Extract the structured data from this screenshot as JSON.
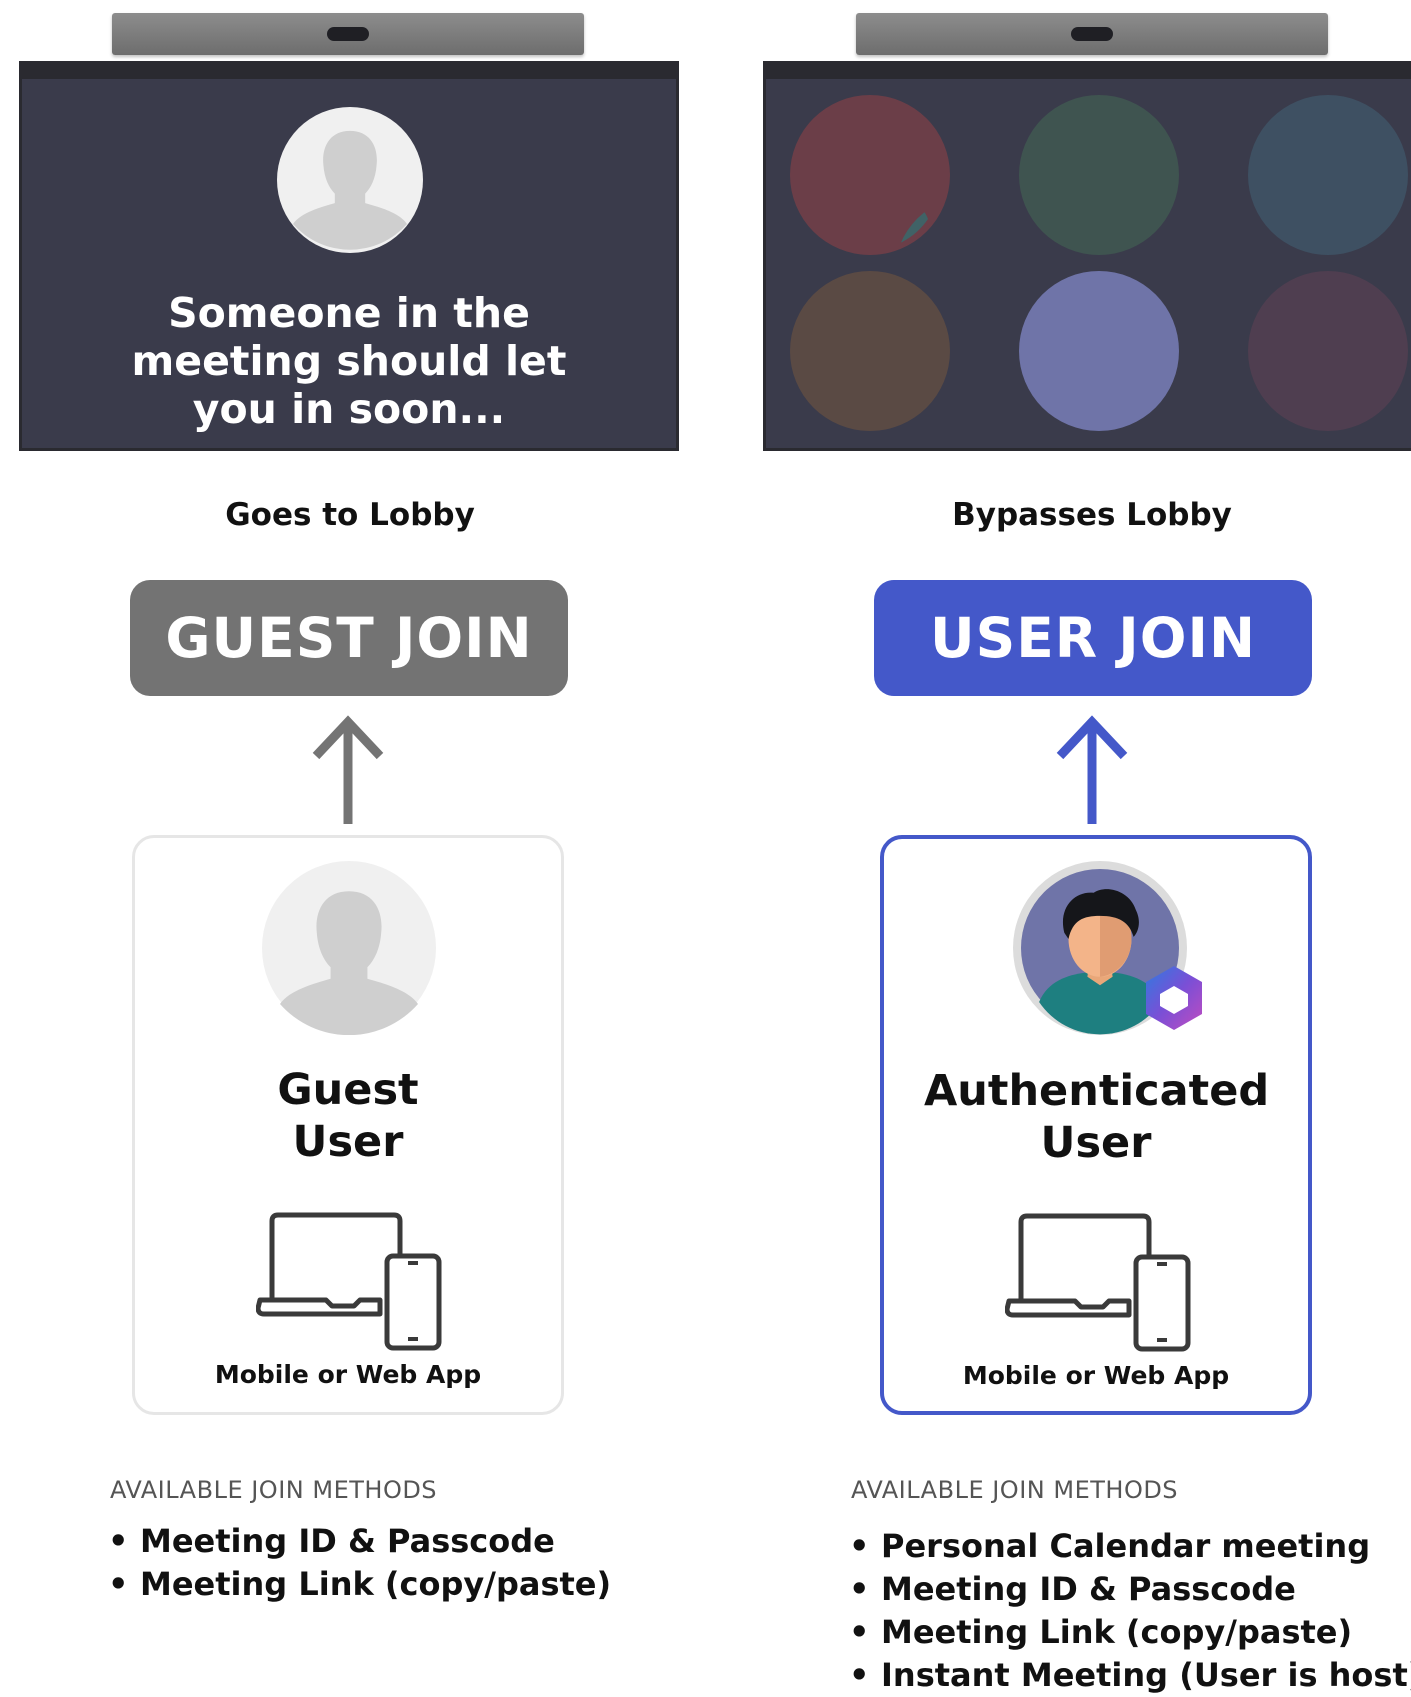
{
  "guest": {
    "screen_text": "Someone in the meeting should let you in soon...",
    "caption": "Goes to Lobby",
    "button": "GUEST JOIN",
    "user_title": "Guest User",
    "device_label": "Mobile or Web App",
    "methods_title": "AVAILABLE JOIN METHODS",
    "methods": [
      "Meeting ID & Passcode",
      "Meeting Link (copy/paste)"
    ]
  },
  "user": {
    "caption": "Bypasses Lobby",
    "button": "USER JOIN",
    "user_title": "Authenticated User",
    "device_label": "Mobile or Web App",
    "methods_title": "AVAILABLE JOIN METHODS",
    "methods": [
      "Personal Calendar meeting",
      "Meeting ID & Passcode",
      "Meeting Link (copy/paste)",
      "Instant Meeting (User is host)"
    ]
  },
  "icons": {
    "guest_avatar": "person-silhouette-icon",
    "user_avatar": "person-avatar-icon",
    "m365": "microsoft-365-icon",
    "devices": "laptop-phone-icon",
    "arrow": "arrow-up-icon"
  },
  "colors": {
    "guest": "#747474",
    "user": "#4458c9",
    "screen": "#3a3b4b"
  }
}
